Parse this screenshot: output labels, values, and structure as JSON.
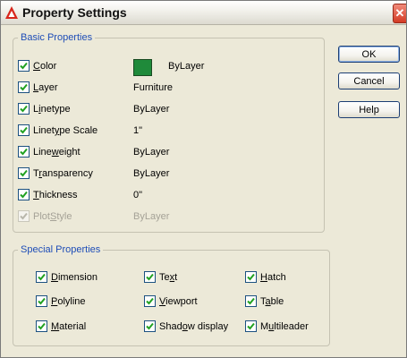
{
  "window": {
    "title": "Property Settings",
    "close_glyph": "✕"
  },
  "basic": {
    "legend": "Basic Properties",
    "rows": [
      {
        "label_pre": "",
        "label_u": "C",
        "label_post": "olor",
        "value": "ByLayer",
        "checked": true
      },
      {
        "label_pre": "",
        "label_u": "L",
        "label_post": "ayer",
        "value": "Furniture",
        "checked": true
      },
      {
        "label_pre": "L",
        "label_u": "i",
        "label_post": "netype",
        "value": "ByLayer",
        "checked": true
      },
      {
        "label_pre": "Linet",
        "label_u": "y",
        "label_post": "pe Scale",
        "value": "1\"",
        "checked": true
      },
      {
        "label_pre": "Line",
        "label_u": "w",
        "label_post": "eight",
        "value": "ByLayer",
        "checked": true
      },
      {
        "label_pre": "T",
        "label_u": "r",
        "label_post": "ansparency",
        "value": "ByLayer",
        "checked": true
      },
      {
        "label_pre": "",
        "label_u": "T",
        "label_post": "hickness",
        "value": "0\"",
        "checked": true
      },
      {
        "label_pre": "Plot",
        "label_u": "S",
        "label_post": "tyle",
        "value": "ByLayer",
        "checked": true,
        "disabled": true
      }
    ]
  },
  "special": {
    "legend": "Special Properties",
    "items": [
      {
        "label_pre": "",
        "label_u": "D",
        "label_post": "imension",
        "checked": true
      },
      {
        "label_pre": "Te",
        "label_u": "x",
        "label_post": "t",
        "checked": true
      },
      {
        "label_pre": "",
        "label_u": "H",
        "label_post": "atch",
        "checked": true
      },
      {
        "label_pre": "",
        "label_u": "P",
        "label_post": "olyline",
        "checked": true
      },
      {
        "label_pre": "",
        "label_u": "V",
        "label_post": "iewport",
        "checked": true
      },
      {
        "label_pre": "T",
        "label_u": "a",
        "label_post": "ble",
        "checked": true
      },
      {
        "label_pre": "",
        "label_u": "M",
        "label_post": "aterial",
        "checked": true
      },
      {
        "label_pre": "Shad",
        "label_u": "o",
        "label_post": "w display",
        "checked": true
      },
      {
        "label_pre": "M",
        "label_u": "u",
        "label_post": "ltileader",
        "checked": true
      }
    ]
  },
  "buttons": {
    "ok": "OK",
    "cancel": "Cancel",
    "help": "Help"
  },
  "colors": {
    "swatch": "#1f8a3a",
    "legend_text": "#1e4db7",
    "checkmark": "#21a121"
  }
}
